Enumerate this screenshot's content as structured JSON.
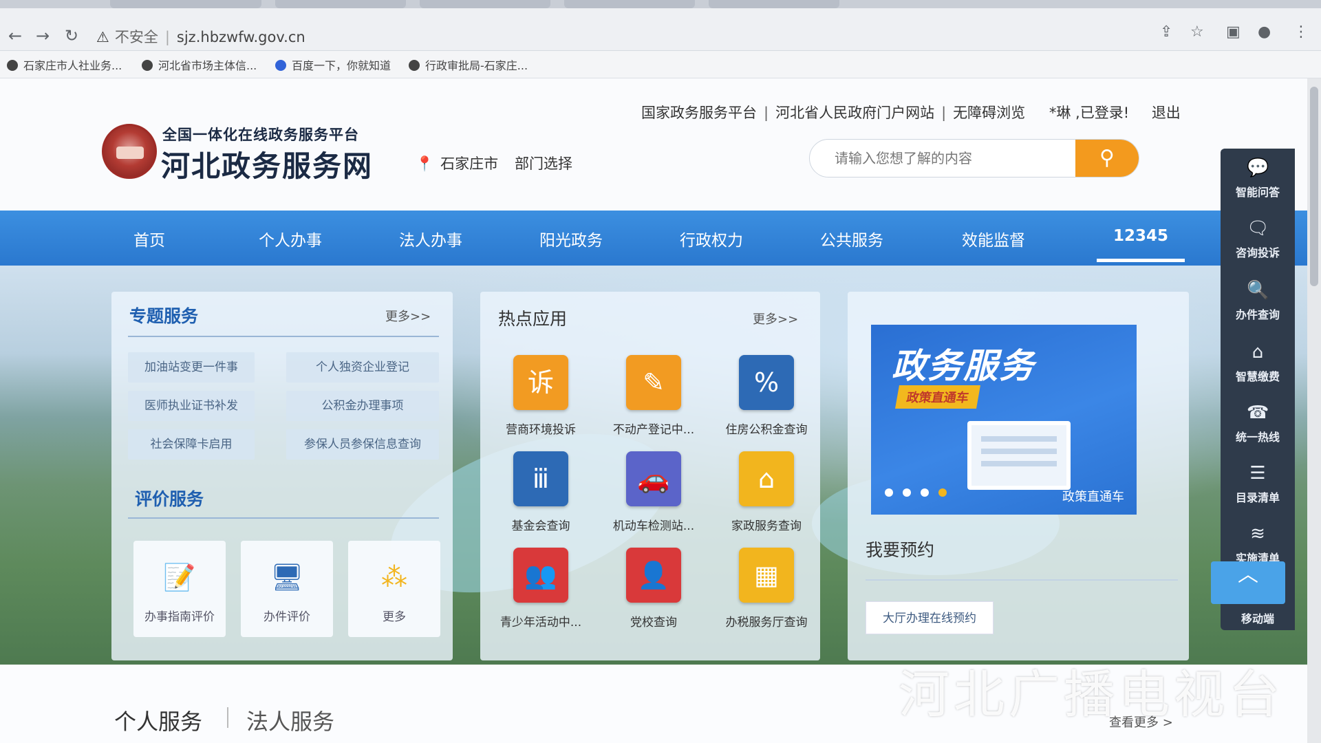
{
  "browser": {
    "url_warning": "不安全",
    "url": "sjz.hbzwfw.gov.cn",
    "bookmarks": [
      "石家庄市人社业务...",
      "河北省市场主体信...",
      "百度一下，你就知道",
      "行政审批局-石家庄..."
    ]
  },
  "header": {
    "logo_sub": "全国一体化在线政务服务平台",
    "logo_main": "河北政务服务网",
    "location": "石家庄市",
    "dept_select": "部门选择",
    "top_links": [
      "国家政务服务平台",
      "河北省人民政府门户网站",
      "无障碍浏览"
    ],
    "user_status": "*琳 ,已登录!",
    "logout": "退出",
    "search_placeholder": "请输入您想了解的内容"
  },
  "nav": {
    "items": [
      "首页",
      "个人办事",
      "法人办事",
      "阳光政务",
      "行政权力",
      "公共服务",
      "效能监督",
      "12345"
    ],
    "active": "12345"
  },
  "topic_services": {
    "title": "专题服务",
    "more": "更多>>",
    "items": [
      "加油站变更一件事",
      "个人独资企业登记",
      "医师执业证书补发",
      "公积金办理事项",
      "社会保障卡启用",
      "参保人员参保信息查询"
    ]
  },
  "evaluation": {
    "title": "评价服务",
    "items": [
      {
        "label": "办事指南评价",
        "icon": "guide-eval-icon"
      },
      {
        "label": "办件评价",
        "icon": "case-eval-icon"
      },
      {
        "label": "更多",
        "icon": "more-grid-icon"
      }
    ]
  },
  "hot_apps": {
    "title": "热点应用",
    "more": "更多>>",
    "items": [
      {
        "label": "营商环境投诉",
        "icon": "complaint-icon",
        "glyph": "诉",
        "color": "orange"
      },
      {
        "label": "不动产登记中...",
        "icon": "edit-icon",
        "glyph": "✎",
        "color": "orange"
      },
      {
        "label": "住房公积金查询",
        "icon": "house-percent-icon",
        "glyph": "%",
        "color": "blue"
      },
      {
        "label": "基金会查询",
        "icon": "foundation-icon",
        "glyph": "ⅲ",
        "color": "blue"
      },
      {
        "label": "机动车检测站...",
        "icon": "car-search-icon",
        "glyph": "🚗",
        "color": "purple"
      },
      {
        "label": "家政服务查询",
        "icon": "housekeeping-icon",
        "glyph": "⌂",
        "color": "yellow"
      },
      {
        "label": "青少年活动中...",
        "icon": "youth-icon",
        "glyph": "👥",
        "color": "red"
      },
      {
        "label": "党校查询",
        "icon": "party-school-icon",
        "glyph": "👤",
        "color": "red"
      },
      {
        "label": "办税服务厅查询",
        "icon": "tax-hall-icon",
        "glyph": "▦",
        "color": "yellow"
      }
    ]
  },
  "banner": {
    "title": "政务服务",
    "subtitle": "政策直通车",
    "caption": "政策直通车"
  },
  "booking": {
    "title": "我要预约",
    "button": "大厅办理在线预约"
  },
  "right_sidebar": [
    {
      "label": "智能问答",
      "icon": "chat-icon",
      "glyph": "💬"
    },
    {
      "label": "咨询投诉",
      "icon": "consult-icon",
      "glyph": "🗨"
    },
    {
      "label": "办件查询",
      "icon": "doc-search-icon",
      "glyph": "🔍"
    },
    {
      "label": "智慧缴费",
      "icon": "payment-icon",
      "glyph": "⌂"
    },
    {
      "label": "统一热线",
      "icon": "phone-icon",
      "glyph": "☎"
    },
    {
      "label": "目录清单",
      "icon": "catalog-icon",
      "glyph": "☰"
    },
    {
      "label": "实施清单",
      "icon": "layers-icon",
      "glyph": "≋"
    },
    {
      "label": "移动端",
      "icon": "mobile-icon",
      "glyph": "▯"
    }
  ],
  "bottom": {
    "tab1": "个人服务",
    "tab2": "法人服务",
    "see_more": "查看更多 >"
  },
  "watermark": "河北广播电视台",
  "colors": {
    "nav_blue": "#2a78cf",
    "search_orange": "#f39a1e",
    "sidebar_dark": "#2f3b4b",
    "title_blue": "#1f5fb0"
  }
}
